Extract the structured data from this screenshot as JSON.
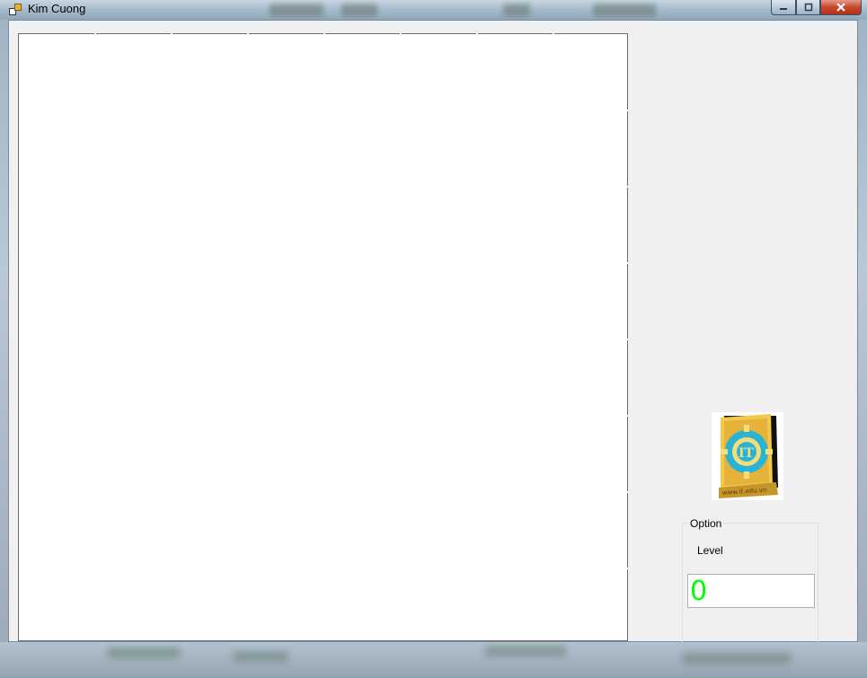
{
  "window": {
    "title": "Kim Cuong",
    "icon": "app-window-icon",
    "controls": {
      "minimize": "minimize-icon",
      "maximize": "maximize-icon",
      "close": "close-icon"
    }
  },
  "board": {
    "name": "game-board"
  },
  "logo": {
    "icon": "it-gear-shield-logo",
    "text": "www.it.edu.vn"
  },
  "option_group": {
    "legend": "Option",
    "level_label": "Level",
    "level_value": "0",
    "level_value_color": "#00ff00"
  }
}
